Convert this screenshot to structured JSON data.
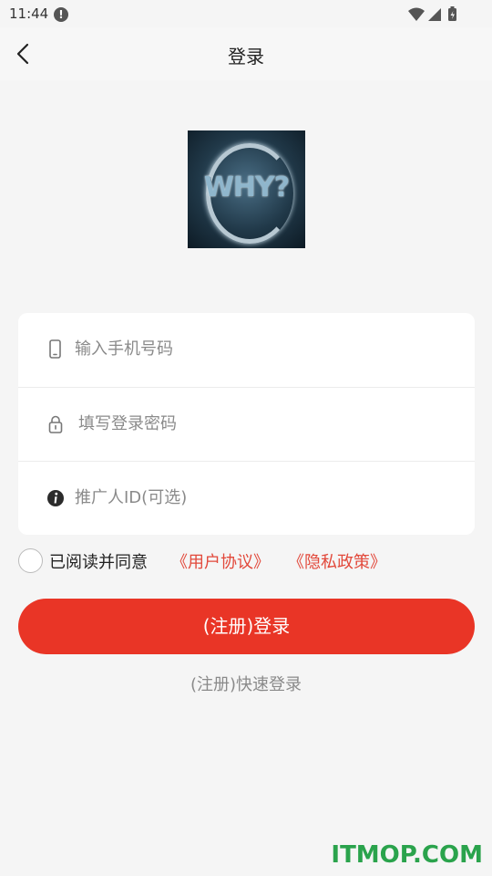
{
  "status_bar": {
    "time": "11:44",
    "alert_icon": "alert-circle-icon"
  },
  "header": {
    "title": "登录",
    "back_icon": "chevron-left-icon"
  },
  "logo": {
    "text": "WHY?"
  },
  "form": {
    "phone": {
      "placeholder": "输入手机号码",
      "icon": "phone-icon"
    },
    "password": {
      "placeholder": "填写登录密码",
      "icon": "lock-icon"
    },
    "referrer": {
      "placeholder": "推广人ID(可选)",
      "icon": "info-icon"
    }
  },
  "agreement": {
    "text": "已阅读并同意",
    "user_agreement": "《用户协议》",
    "privacy_policy": "《隐私政策》",
    "checked": false
  },
  "actions": {
    "login_label": "(注册)登录",
    "quick_login_label": "(注册)快速登录"
  },
  "watermark": "ITMOP.COM",
  "colors": {
    "accent": "#e93526",
    "link": "#e2483a",
    "background": "#f5f5f5",
    "watermark": "#2aa34c"
  }
}
